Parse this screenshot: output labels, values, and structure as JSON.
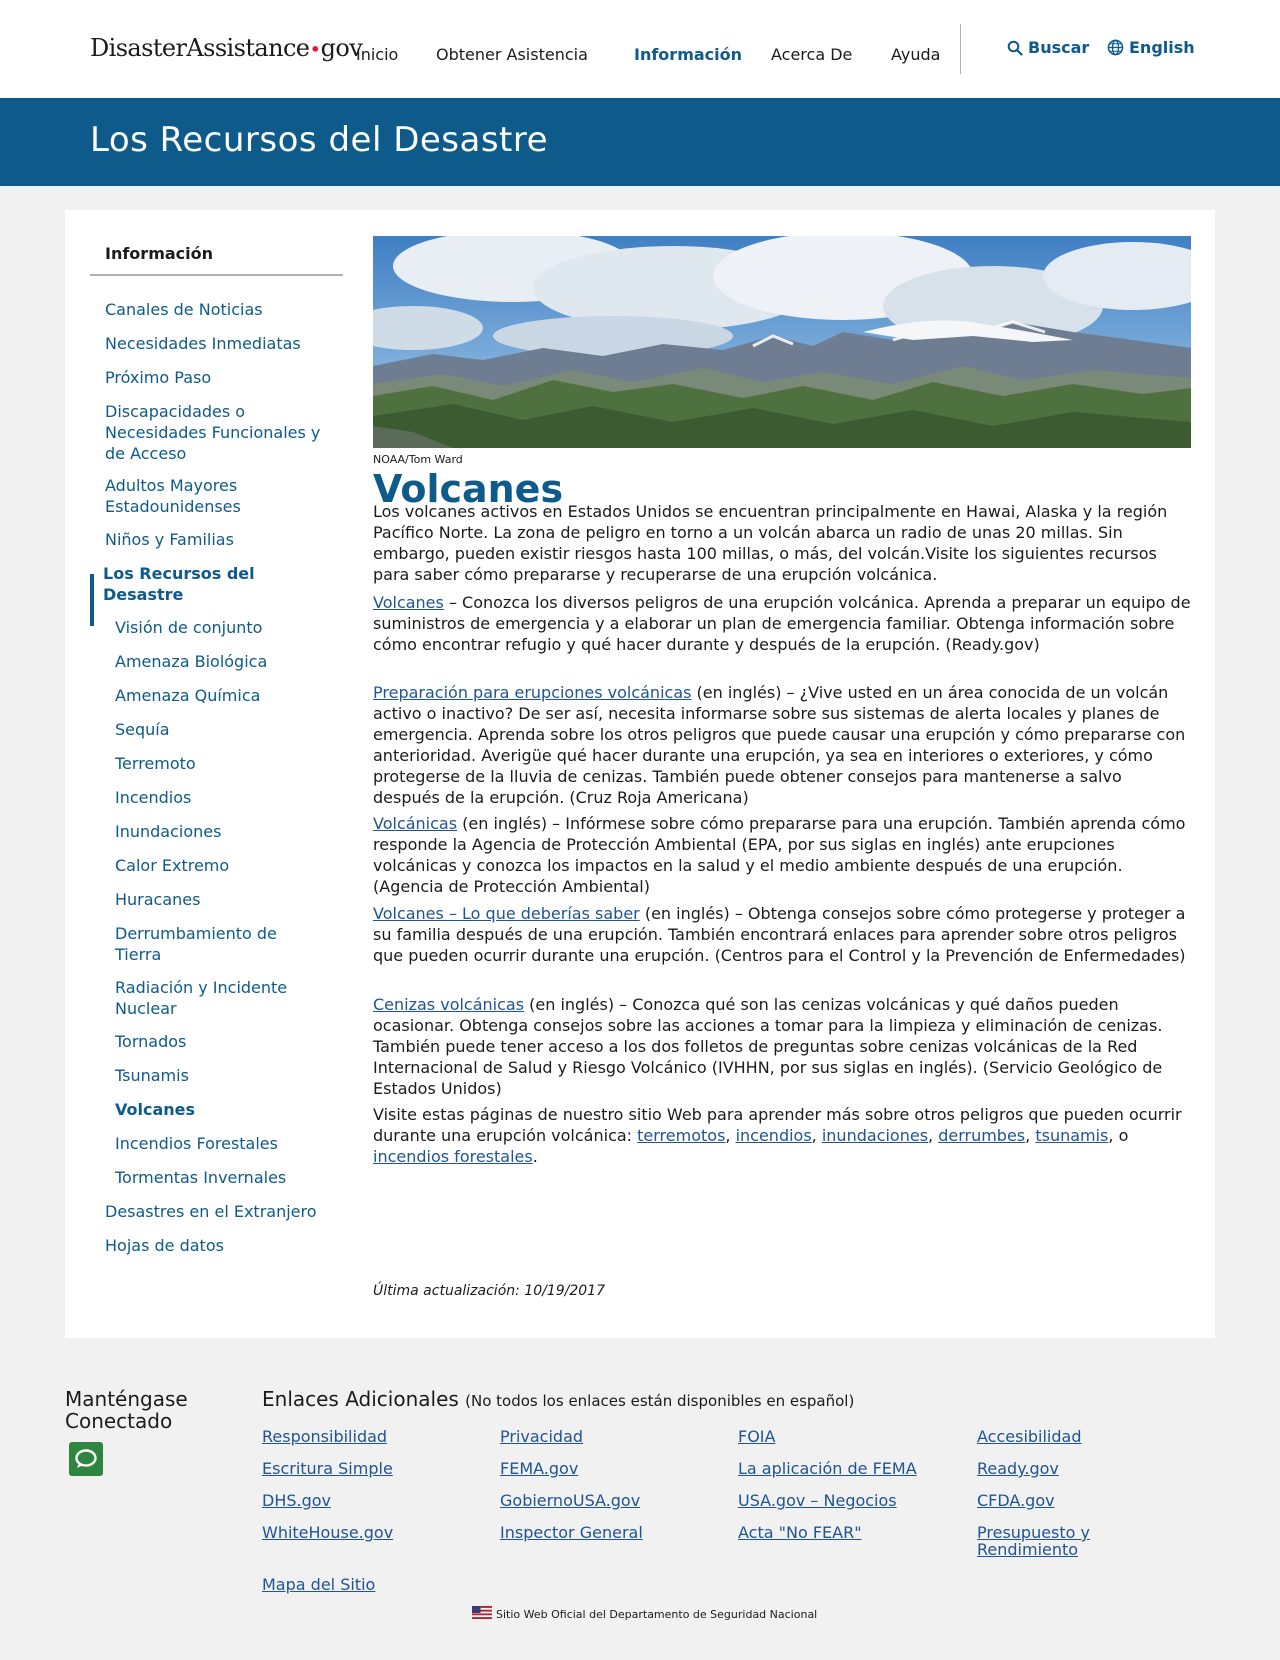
{
  "header": {
    "logo_main": "DisasterAssistance",
    "logo_dot": "•",
    "logo_tld": "gov",
    "nav": [
      "Inicio",
      "Obtener Asistencia",
      "Información",
      "Acerca De",
      "Ayuda"
    ],
    "active_nav": "Información",
    "search_label": "Buscar",
    "language_label": "English"
  },
  "banner": {
    "title": "Los Recursos del Desastre"
  },
  "sidebar": {
    "title": "Información",
    "items": [
      "Canales de Noticias",
      "Necesidades Inmediatas",
      "Próximo Paso",
      "Discapacidades o Necesidades Funcionales y de Acceso",
      "Adultos Mayores Estadounidenses",
      "Niños y Familias",
      "Los Recursos del Desastre",
      "Desastres en el Extranjero",
      "Hojas de datos"
    ],
    "subitems": [
      "Visión de conjunto",
      "Amenaza Biológica",
      "Amenaza Química",
      "Sequía",
      "Terremoto",
      "Incendios",
      "Inundaciones",
      "Calor Extremo",
      "Huracanes",
      "Derrumbamiento de Tierra",
      "Radiación y Incidente Nuclear",
      "Tornados",
      "Tsunamis",
      "Volcanes",
      "Incendios Forestales",
      "Tormentas Invernales"
    ]
  },
  "content": {
    "image_credit": "NOAA/Tom Ward",
    "title": "Volcanes",
    "intro": "Los volcanes activos en Estados Unidos se encuentran principalmente en Hawai, Alaska y la región Pacífico Norte. La zona de peligro en torno a un volcán abarca un radio de unas 20 millas. Sin embargo, pueden existir riesgos hasta 100 millas, o más, del volcán.Visite los siguientes recursos para saber cómo prepararse y recuperarse de una erupción volcánica.",
    "resources": [
      {
        "link": "Volcanes",
        "text": " – Conozca los diversos peligros de una erupción volcánica. Aprenda a preparar un equipo de suministros de emergencia y a elaborar un plan de emergencia familiar. Obtenga información sobre cómo encontrar refugio y qué hacer durante y después de la erupción. (Ready.gov)"
      },
      {
        "link": "Preparación para erupciones volcánicas",
        "text": " (en inglés) – ¿Vive usted en un área conocida de un volcán activo o inactivo? De ser así, necesita informarse sobre sus sistemas de alerta locales y planes de emergencia. Aprenda sobre los otros peligros que puede causar una erupción y cómo prepararse con anterioridad. Averigüe qué hacer durante una erupción, ya sea en interiores o exteriores, y cómo protegerse de la lluvia de cenizas. También puede obtener consejos para mantenerse a salvo después de la erupción. (Cruz Roja Americana)"
      },
      {
        "link": "Volcánicas",
        "text": " (en inglés) – Infórmese sobre cómo prepararse para una erupción. También aprenda cómo responde la Agencia de Protección Ambiental (EPA, por sus siglas en inglés) ante erupciones volcánicas y conozca los impactos en la salud y el medio ambiente después de una erupción. (Agencia de Protección Ambiental)"
      },
      {
        "link": "Volcanes – Lo que deberías saber",
        "text": " (en inglés) – Obtenga consejos sobre cómo protegerse y proteger a su familia después de una erupción. También encontrará enlaces para aprender sobre otros peligros que pueden ocurrir durante una erupción. (Centros para el Control y la Prevención de Enfermedades)"
      },
      {
        "link": "Cenizas volcánicas",
        "text": " (en inglés) – Conozca qué son las cenizas volcánicas y qué daños pueden ocasionar. Obtenga consejos sobre las acciones a tomar para la limpieza y eliminación de cenizas. También puede tener acceso a los dos folletos de preguntas sobre cenizas volcánicas de la Red Internacional de Salud y Riesgo Volcánico (IVHHN, por sus siglas en inglés). (Servicio Geológico de Estados Unidos)"
      }
    ],
    "closing_text": "Visite estas páginas de nuestro sitio Web para aprender más sobre otros peligros que pueden ocurrir durante una erupción volcánica: ",
    "closing_links": [
      "terremotos",
      "incendios",
      "inundaciones",
      "derrumbes",
      "tsunamis",
      "incendios forestales"
    ],
    "closing_seps": [
      ", ",
      ", ",
      ", ",
      ",",
      ", o ",
      "."
    ],
    "last_updated": "Última actualización: 10/19/2017"
  },
  "footer": {
    "stay_connected": "Manténgase Conectado",
    "links_title": "Enlaces Adicionales",
    "links_note": "(No todos los enlaces están disponibles en español)",
    "links": [
      "Responsibilidad",
      "Privacidad",
      "FOIA",
      "Accesibilidad",
      "Escritura Simple",
      "FEMA.gov",
      "La aplicación de FEMA",
      "Ready.gov",
      "DHS.gov",
      "GobiernoUSA.gov",
      "USA.gov – Negocios",
      "CFDA.gov",
      "WhiteHouse.gov",
      "Inspector General",
      "Acta \"No FEAR\"",
      "Presupuesto y Rendimiento",
      "Mapa del Sitio"
    ],
    "official_text": "Sitio Web Oficial del Departamento de Seguridad Nacional"
  },
  "colors": {
    "primary": "#0e5a8a",
    "link": "#205493",
    "accent_red": "#e31c3d",
    "chat_green": "#2e8540",
    "page_bg": "#f1f1f1"
  }
}
